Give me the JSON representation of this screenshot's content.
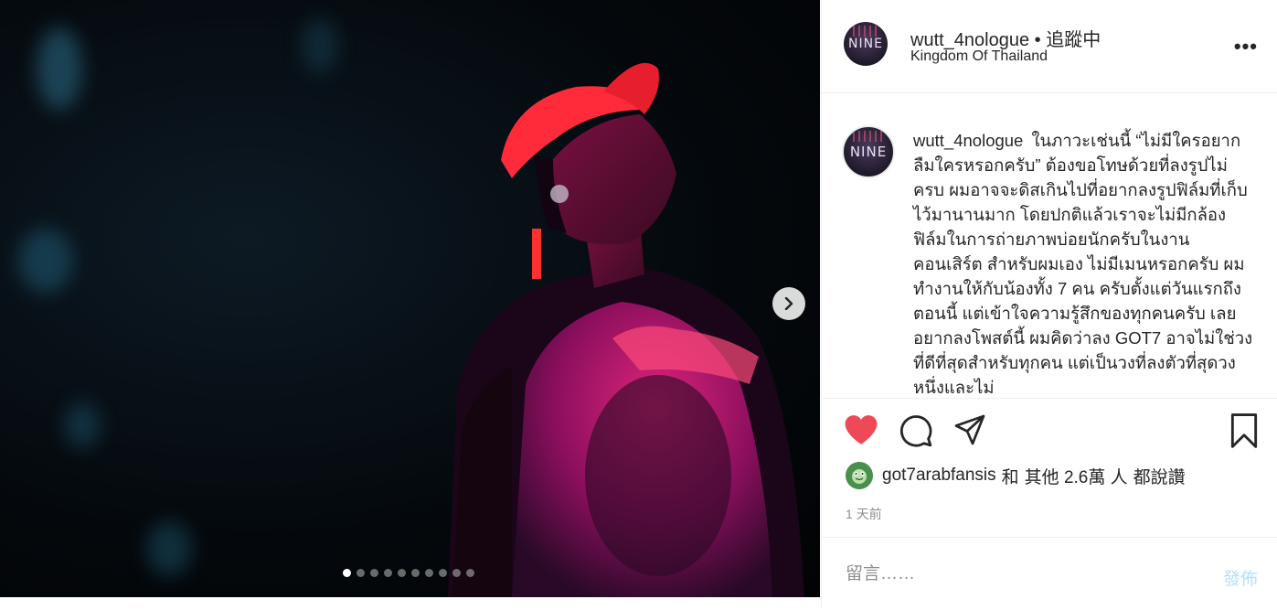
{
  "post": {
    "username": "wutt_4nologue",
    "follow_status": "• 追蹤中",
    "location": "Kingdom Of Thailand",
    "avatar_text": "NINE",
    "more_label": "•••"
  },
  "caption": {
    "username": "wutt_4nologue",
    "text": "ในภาวะเช่นนี้ “ไม่มีใครอยากลืมใครหรอกครับ” ต้องขอโทษด้วยที่ลงรูปไม่ครบ ผมอาจจะดิสเกินไปที่อยากลงรูปฟิล์มที่เก็บไว้มานานมาก โดยปกติแล้วเราจะไม่มีกล้องฟิล์มในการถ่ายภาพบ่อยนักครับในงานคอนเสิร์ต สำหรับผมเอง ไม่มีเมนหรอกครับ ผมทำงานให้กับน้องทั้ง 7 คน ครับตั้งแต่วันแรกถึงตอนนี้ แต่เข้าใจความรู้สึกของทุกคนครับ เลยอยากลงโพสต์นี้ ผมคิดว่าลง GOT7 อาจไม่ใช่วงที่ดีที่สุดสำหรับทุกคน แต่เป็นวงที่ลงตัวที่สุดวงหนึ่งและไม่"
  },
  "likes": {
    "user": "got7arabfansis",
    "conj": "和",
    "others": "其他 2.6萬 人",
    "suffix": "都說讚"
  },
  "time": "1 天前",
  "comment": {
    "placeholder": "留言……",
    "post_label": "發佈"
  },
  "carousel": {
    "count": 10,
    "active": 0
  },
  "colors": {
    "like_red": "#ed4956",
    "post_blue": "#b2dffc",
    "text": "#262626",
    "muted": "#8e8e8e"
  },
  "icons": [
    "heart-icon",
    "comment-icon",
    "share-icon",
    "bookmark-icon",
    "chevron-right-icon"
  ]
}
